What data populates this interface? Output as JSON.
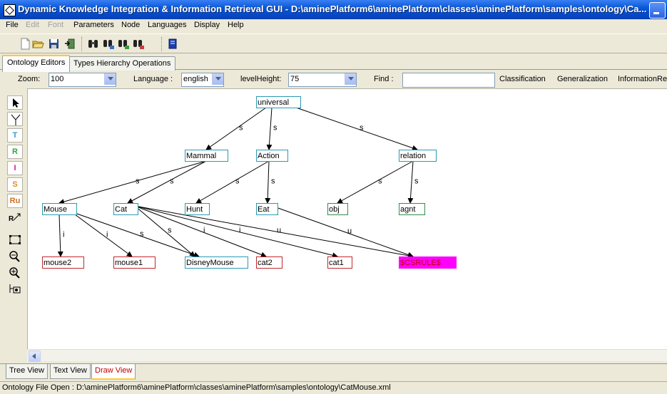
{
  "window": {
    "title": "Dynamic Knowledge Integration & Information Retrieval GUI - D:\\aminePlatform6\\aminePlatform\\classes\\aminePlatform\\samples\\ontology\\Ca..."
  },
  "menu": [
    {
      "label": "File",
      "enabled": true
    },
    {
      "label": "Edit",
      "enabled": false
    },
    {
      "label": "Font",
      "enabled": false
    },
    {
      "label": "Parameters",
      "enabled": true
    },
    {
      "label": "Node",
      "enabled": true
    },
    {
      "label": "Languages",
      "enabled": true
    },
    {
      "label": "Display",
      "enabled": true
    },
    {
      "label": "Help",
      "enabled": true
    }
  ],
  "toolbar_icons": [
    "new-file-icon",
    "open-folder-icon",
    "save-icon",
    "exit-icon",
    "binoculars-icon",
    "binoculars-find-next-icon",
    "binoculars-find-prev-icon",
    "binoculars-replace-icon",
    "help-book-icon"
  ],
  "tabs_top": [
    {
      "label": "Ontology Editors",
      "active": true
    },
    {
      "label": "Types Hierarchy Operations",
      "active": false
    }
  ],
  "controls": {
    "zoom_label": "Zoom:",
    "zoom_value": "100",
    "language_label": "Language :",
    "language_value": "english",
    "level_height_label": "levelHeight:",
    "level_height_value": "75",
    "find_label": "Find :",
    "find_value": "",
    "classification": "Classification",
    "generalization": "Generalization",
    "information_retrieval": "InformationRet"
  },
  "side_tools": [
    {
      "name": "select-arrow-icon",
      "label": "",
      "color": "#000000"
    },
    {
      "name": "specialization-link-icon",
      "label": "",
      "color": "#000000"
    },
    {
      "name": "type-node-tool",
      "label": "T",
      "color": "#3a9ad9"
    },
    {
      "name": "relation-node-tool",
      "label": "R",
      "color": "#2eaa3c"
    },
    {
      "name": "individual-node-tool",
      "label": "I",
      "color": "#c8208c"
    },
    {
      "name": "situation-node-tool",
      "label": "S",
      "color": "#e08a30"
    },
    {
      "name": "rule-node-tool",
      "label": "Ru",
      "color": "#d07020"
    },
    {
      "name": "edge-link-icon",
      "label": "",
      "color": "#000000"
    },
    {
      "name": "fit-layout-icon",
      "label": "",
      "color": "#000000"
    },
    {
      "name": "zoom-out-icon",
      "label": "",
      "color": "#000000"
    },
    {
      "name": "zoom-in-icon",
      "label": "",
      "color": "#000000"
    },
    {
      "name": "pan-zoom-icon",
      "label": "",
      "color": "#000000"
    }
  ],
  "graph": {
    "nodes": [
      {
        "id": "universal",
        "label": "universal",
        "kind": "type"
      },
      {
        "id": "Mammal",
        "label": "Mammal",
        "kind": "type"
      },
      {
        "id": "Action",
        "label": "Action",
        "kind": "type"
      },
      {
        "id": "relation",
        "label": "relation",
        "kind": "type"
      },
      {
        "id": "Mouse",
        "label": "Mouse",
        "kind": "type"
      },
      {
        "id": "Cat",
        "label": "Cat",
        "kind": "type"
      },
      {
        "id": "Hunt",
        "label": "Hunt",
        "kind": "type"
      },
      {
        "id": "Eat",
        "label": "Eat",
        "kind": "type"
      },
      {
        "id": "obj",
        "label": "obj",
        "kind": "relation"
      },
      {
        "id": "agnt",
        "label": "agnt",
        "kind": "relation"
      },
      {
        "id": "mouse2",
        "label": "mouse2",
        "kind": "individual"
      },
      {
        "id": "mouse1",
        "label": "mouse1",
        "kind": "individual"
      },
      {
        "id": "DisneyMouse",
        "label": "DisneyMouse",
        "kind": "type"
      },
      {
        "id": "cat2",
        "label": "cat2",
        "kind": "individual"
      },
      {
        "id": "cat1",
        "label": "cat1",
        "kind": "individual"
      },
      {
        "id": "CSRULE",
        "label": "$CSRULE$",
        "kind": "rule"
      }
    ],
    "edges": [
      {
        "from": "universal",
        "to": "Mammal",
        "label": "s"
      },
      {
        "from": "universal",
        "to": "Action",
        "label": "s"
      },
      {
        "from": "universal",
        "to": "relation",
        "label": "s"
      },
      {
        "from": "Mammal",
        "to": "Mouse",
        "label": "s"
      },
      {
        "from": "Mammal",
        "to": "Cat",
        "label": "s"
      },
      {
        "from": "Action",
        "to": "Hunt",
        "label": "s"
      },
      {
        "from": "Action",
        "to": "Eat",
        "label": "s"
      },
      {
        "from": "relation",
        "to": "obj",
        "label": "s"
      },
      {
        "from": "relation",
        "to": "agnt",
        "label": "s"
      },
      {
        "from": "Mouse",
        "to": "mouse2",
        "label": "i"
      },
      {
        "from": "Mouse",
        "to": "mouse1",
        "label": "i"
      },
      {
        "from": "Mouse",
        "to": "DisneyMouse",
        "label": "s"
      },
      {
        "from": "Cat",
        "to": "DisneyMouse",
        "label": "s"
      },
      {
        "from": "Cat",
        "to": "cat2",
        "label": "i"
      },
      {
        "from": "Cat",
        "to": "cat1",
        "label": "i"
      },
      {
        "from": "Cat",
        "to": "CSRULE",
        "label": "u"
      },
      {
        "from": "Eat",
        "to": "CSRULE",
        "label": "u"
      }
    ],
    "colors": {
      "type": "#2a9bb3",
      "relation": "#2e8f4c",
      "individual": "#c0282b",
      "rule_fill": "#ff00ff",
      "rule_text": "#c00000"
    }
  },
  "tabs_bottom": [
    {
      "label": "Tree View",
      "active": false
    },
    {
      "label": "Text View",
      "active": false
    },
    {
      "label": "Draw View",
      "active": true
    }
  ],
  "status": "Ontology File Open : D:\\aminePlatform6\\aminePlatform\\classes\\aminePlatform\\samples\\ontology\\CatMouse.xml"
}
